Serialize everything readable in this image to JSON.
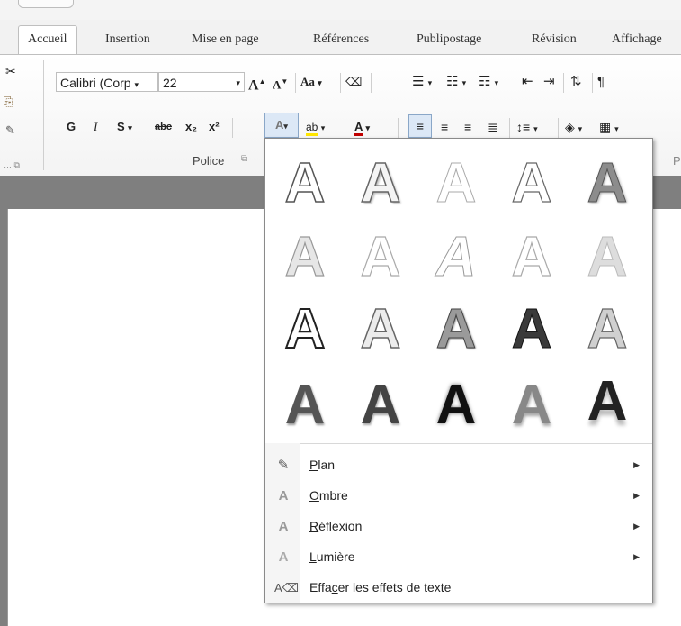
{
  "tabs": [
    {
      "label": "Accueil"
    },
    {
      "label": "Insertion"
    },
    {
      "label": "Mise en page"
    },
    {
      "label": "Références"
    },
    {
      "label": "Publipostage"
    },
    {
      "label": "Révision"
    },
    {
      "label": "Affichage"
    }
  ],
  "ribbon": {
    "font_name": "Calibri (Corp",
    "font_size": "22",
    "grow": "A",
    "shrink": "A",
    "case": "Aa",
    "bold": "G",
    "italic": "I",
    "underline": "S",
    "strike": "abc",
    "subscript": "x₂",
    "superscript": "x²",
    "group_police": "Police",
    "group_label_right": "P"
  },
  "dropdown": {
    "gallery_glyph": "A",
    "menu": [
      {
        "label_pre": "",
        "label_u": "P",
        "label_post": "lan",
        "icon": "outline-pen-icon",
        "has_arrow": true
      },
      {
        "label_pre": "",
        "label_u": "O",
        "label_post": "mbre",
        "icon": "shadow-icon",
        "has_arrow": true
      },
      {
        "label_pre": "",
        "label_u": "R",
        "label_post": "éflexion",
        "icon": "reflection-icon",
        "has_arrow": true
      },
      {
        "label_pre": "",
        "label_u": "L",
        "label_post": "umière",
        "icon": "glow-icon",
        "has_arrow": true
      },
      {
        "label_pre": "Effa",
        "label_u": "c",
        "label_post": "er les effets de texte",
        "icon": "clear-effects-icon",
        "has_arrow": false
      }
    ]
  }
}
